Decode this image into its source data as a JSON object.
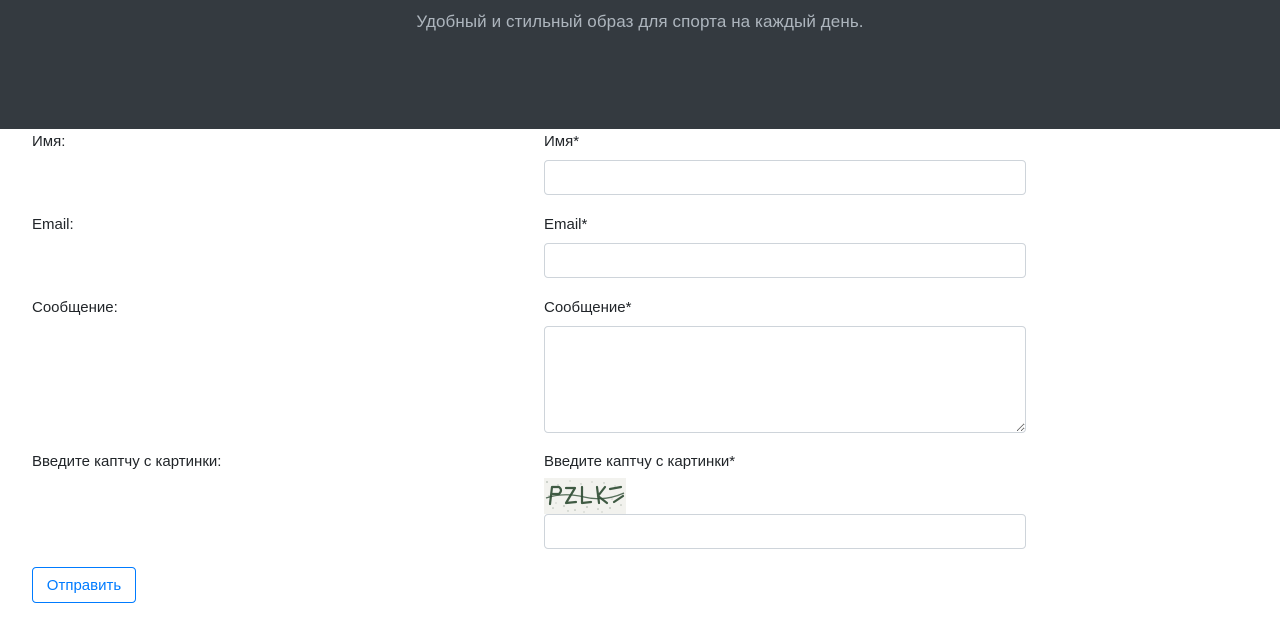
{
  "hero": {
    "tagline": "Удобный и стильный образ для спорта на каждый день."
  },
  "form": {
    "rows": [
      {
        "row_label": "Имя:",
        "field_label": "Имя*",
        "value": ""
      },
      {
        "row_label": "Email:",
        "field_label": "Email*",
        "value": ""
      },
      {
        "row_label": "Сообщение:",
        "field_label": "Сообщение*",
        "value": ""
      },
      {
        "row_label": "Введите каптчу с картинки:",
        "field_label": "Введите каптчу с картинки*",
        "value": ""
      }
    ],
    "captcha_icon": "captcha-image",
    "submit_label": "Отправить"
  },
  "colors": {
    "hero_bg": "#343a40",
    "hero_text": "#adb5bd",
    "accent": "#007bff",
    "input_border": "#ced4da"
  }
}
